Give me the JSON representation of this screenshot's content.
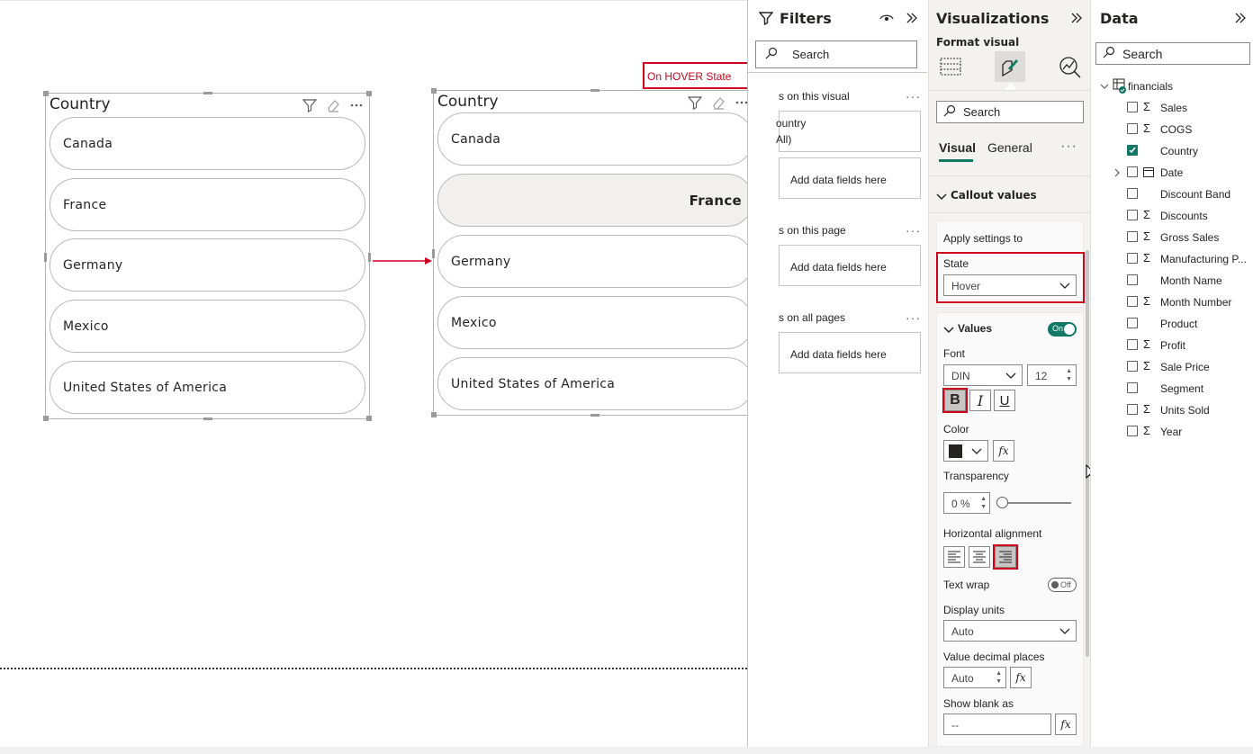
{
  "slicer_left": {
    "title": "Country",
    "items": [
      "Canada",
      "France",
      "Germany",
      "Mexico",
      "United States of America"
    ]
  },
  "slicer_right": {
    "title": "Country",
    "items": [
      "Canada",
      "France",
      "Germany",
      "Mexico",
      "United States of America"
    ],
    "hovered_item": "France"
  },
  "annotation": {
    "label": "On HOVER State"
  },
  "filters": {
    "title": "Filters",
    "search_placeholder": "Search",
    "sections": [
      {
        "label": "s on this visual"
      },
      {
        "label": "s on this page"
      },
      {
        "label": "s on all pages"
      }
    ],
    "visual_filter_field": "ountry",
    "visual_filter_value": "All)",
    "add_fields": "Add data fields here"
  },
  "visualizations": {
    "title": "Visualizations",
    "subtitle": "Format visual",
    "search_placeholder": "Search",
    "tabs": [
      "Visual",
      "General"
    ],
    "section": "Callout values",
    "apply_settings_to": "Apply settings to",
    "state_label": "State",
    "state_value": "Hover",
    "values_label": "Values",
    "values_toggle": "On",
    "font_label": "Font",
    "font_family": "DIN",
    "font_size": "12",
    "bold": "B",
    "italic": "I",
    "underline": "U",
    "color_label": "Color",
    "transparency_label": "Transparency",
    "transparency_value": "0 %",
    "transparency_level": 0,
    "halign_label": "Horizontal alignment",
    "text_wrap_label": "Text wrap",
    "text_wrap_toggle": "Off",
    "display_units_label": "Display units",
    "display_units_value": "Auto",
    "decimal_label": "Value decimal places",
    "decimal_value": "Auto",
    "blank_label": "Show blank as",
    "blank_value": "--",
    "fx": "fx",
    "color_swatch": "#252423"
  },
  "data_pane": {
    "title": "Data",
    "search_placeholder": "Search",
    "table_name": "financials",
    "fields": [
      {
        "name": "Sales",
        "sigma": true,
        "checked": false
      },
      {
        "name": "COGS",
        "sigma": true,
        "checked": false
      },
      {
        "name": "Country",
        "sigma": false,
        "checked": true
      },
      {
        "name": "Date",
        "sigma": false,
        "checked": false,
        "expandable": true
      },
      {
        "name": "Discount Band",
        "sigma": false,
        "checked": false
      },
      {
        "name": "Discounts",
        "sigma": true,
        "checked": false
      },
      {
        "name": "Gross Sales",
        "sigma": true,
        "checked": false
      },
      {
        "name": "Manufacturing P...",
        "sigma": true,
        "checked": false
      },
      {
        "name": "Month Name",
        "sigma": false,
        "checked": false
      },
      {
        "name": "Month Number",
        "sigma": true,
        "checked": false
      },
      {
        "name": "Product",
        "sigma": false,
        "checked": false
      },
      {
        "name": "Profit",
        "sigma": true,
        "checked": false
      },
      {
        "name": "Sale Price",
        "sigma": true,
        "checked": false
      },
      {
        "name": "Segment",
        "sigma": false,
        "checked": false
      },
      {
        "name": "Units Sold",
        "sigma": true,
        "checked": false
      },
      {
        "name": "Year",
        "sigma": true,
        "checked": false
      }
    ]
  },
  "colors": {
    "accent": "#117865",
    "highlight": "#d0021b"
  }
}
